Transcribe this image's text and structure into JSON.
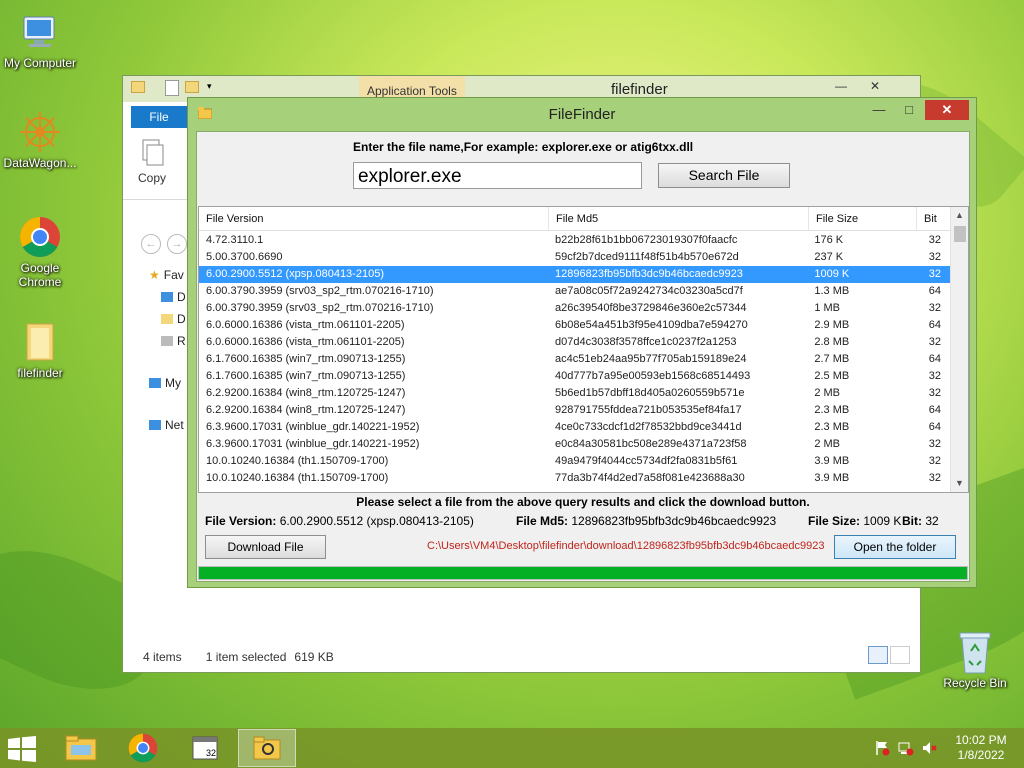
{
  "desktop": {
    "icons": [
      {
        "label": "My Computer"
      },
      {
        "label": "DataWagon..."
      },
      {
        "label": "Google Chrome"
      },
      {
        "label": "filefinder"
      },
      {
        "label": "Recycle Bin"
      }
    ]
  },
  "explorer": {
    "title": "filefinder",
    "app_tools": "Application Tools",
    "file_tab": "File",
    "copy_label": "Copy",
    "nav": [
      "Fav",
      "D",
      "D",
      "R",
      "My",
      "Net"
    ],
    "status_items": "4 items",
    "status_selected": "1 item selected",
    "status_size": "619 KB"
  },
  "filefinder": {
    "title": "FileFinder",
    "prompt": "Enter the file name,For example: explorer.exe or atig6txx.dll",
    "query": "explorer.exe",
    "search_button": "Search File",
    "columns": [
      "File Version",
      "File Md5",
      "File Size",
      "Bit"
    ],
    "rows": [
      {
        "version": "4.72.3110.1",
        "md5": "b22b28f61b1bb06723019307f0faacfc",
        "size": "176 K",
        "bit": "32",
        "selected": false
      },
      {
        "version": "5.00.3700.6690",
        "md5": "59cf2b7dced9111f48f51b4b570e672d",
        "size": "237 K",
        "bit": "32",
        "selected": false
      },
      {
        "version": "6.00.2900.5512 (xpsp.080413-2105)",
        "md5": "12896823fb95bfb3dc9b46bcaedc9923",
        "size": "1009 K",
        "bit": "32",
        "selected": true
      },
      {
        "version": "6.00.3790.3959 (srv03_sp2_rtm.070216-1710)",
        "md5": "ae7a08c05f72a9242734c03230a5cd7f",
        "size": "1.3 MB",
        "bit": "64",
        "selected": false
      },
      {
        "version": "6.00.3790.3959 (srv03_sp2_rtm.070216-1710)",
        "md5": "a26c39540f8be3729846e360e2c57344",
        "size": "1 MB",
        "bit": "32",
        "selected": false
      },
      {
        "version": "6.0.6000.16386 (vista_rtm.061101-2205)",
        "md5": "6b08e54a451b3f95e4109dba7e594270",
        "size": "2.9 MB",
        "bit": "64",
        "selected": false
      },
      {
        "version": "6.0.6000.16386 (vista_rtm.061101-2205)",
        "md5": "d07d4c3038f3578ffce1c0237f2a1253",
        "size": "2.8 MB",
        "bit": "32",
        "selected": false
      },
      {
        "version": "6.1.7600.16385 (win7_rtm.090713-1255)",
        "md5": "ac4c51eb24aa95b77f705ab159189e24",
        "size": "2.7 MB",
        "bit": "64",
        "selected": false
      },
      {
        "version": "6.1.7600.16385 (win7_rtm.090713-1255)",
        "md5": "40d777b7a95e00593eb1568c68514493",
        "size": "2.5 MB",
        "bit": "32",
        "selected": false
      },
      {
        "version": "6.2.9200.16384 (win8_rtm.120725-1247)",
        "md5": "5b6ed1b57dbff18d405a0260559b571e",
        "size": "2 MB",
        "bit": "32",
        "selected": false
      },
      {
        "version": "6.2.9200.16384 (win8_rtm.120725-1247)",
        "md5": "928791755fddea721b053535ef84fa17",
        "size": "2.3 MB",
        "bit": "64",
        "selected": false
      },
      {
        "version": "6.3.9600.17031 (winblue_gdr.140221-1952)",
        "md5": "4ce0c733cdcf1d2f78532bbd9ce3441d",
        "size": "2.3 MB",
        "bit": "64",
        "selected": false
      },
      {
        "version": "6.3.9600.17031 (winblue_gdr.140221-1952)",
        "md5": "e0c84a30581bc508e289e4371a723f58",
        "size": "2 MB",
        "bit": "32",
        "selected": false
      },
      {
        "version": "10.0.10240.16384 (th1.150709-1700)",
        "md5": "49a9479f4044cc5734df2fa0831b5f61",
        "size": "3.9 MB",
        "bit": "32",
        "selected": false
      },
      {
        "version": "10.0.10240.16384 (th1.150709-1700)",
        "md5": "77da3b74f4d2ed7a58f081e423688a30",
        "size": "3.9 MB",
        "bit": "32",
        "selected": false
      }
    ],
    "hint": "Please select a file from the above query results and click the download button.",
    "info": {
      "version_label": "File Version:",
      "version_value": "6.00.2900.5512 (xpsp.080413-2105)",
      "md5_label": "File Md5:",
      "md5_value": "12896823fb95bfb3dc9b46bcaedc9923",
      "size_label": "File Size:",
      "size_value": "1009 K",
      "bit_label": "Bit:",
      "bit_value": "32"
    },
    "download_button": "Download File",
    "download_path": "C:\\Users\\VM4\\Desktop\\filefinder\\download\\12896823fb95bfb3dc9b46bcaedc9923",
    "open_folder_button": "Open the folder",
    "progress": 1.0
  },
  "taskbar": {
    "time": "10:02 PM",
    "date": "1/8/2022"
  }
}
